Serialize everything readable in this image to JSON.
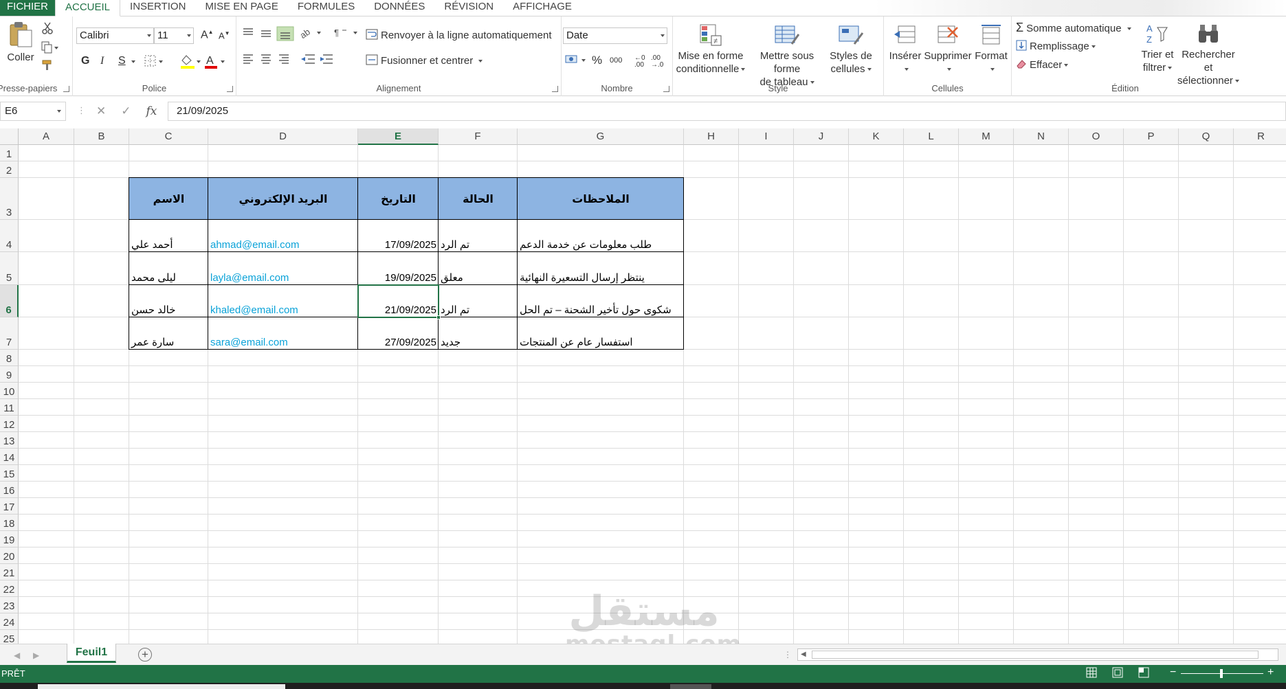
{
  "ribbon_tabs": [
    "FICHIER",
    "ACCUEIL",
    "INSERTION",
    "MISE EN PAGE",
    "FORMULES",
    "DONNÉES",
    "RÉVISION",
    "AFFICHAGE"
  ],
  "clipboard": {
    "paste": "Coller",
    "group": "Presse-papiers"
  },
  "font": {
    "name": "Calibri",
    "size": "11",
    "bold": "G",
    "italic": "I",
    "underline": "S",
    "group": "Police"
  },
  "alignment": {
    "wrap": "Renvoyer à la ligne automatiquement",
    "merge": "Fusionner et centrer",
    "group": "Alignement"
  },
  "number": {
    "format": "Date",
    "percent": "%",
    "thousands": "000",
    "group": "Nombre"
  },
  "style": {
    "conditional": [
      "Mise en forme",
      "conditionnelle"
    ],
    "table": [
      "Mettre sous forme",
      "de tableau"
    ],
    "cell_styles": [
      "Styles de",
      "cellules"
    ],
    "group": "Style"
  },
  "cells": {
    "insert": "Insérer",
    "delete": "Supprimer",
    "format": "Format",
    "group": "Cellules"
  },
  "editing": {
    "autosum": "Somme automatique",
    "fill": "Remplissage",
    "clear": "Effacer",
    "sort": [
      "Trier et",
      "filtrer"
    ],
    "find": [
      "Rechercher et",
      "sélectionner"
    ],
    "group": "Édition"
  },
  "formula_bar": {
    "name_box": "E6",
    "fx": "fx",
    "value": "21/09/2025"
  },
  "columns": [
    "A",
    "B",
    "C",
    "D",
    "E",
    "F",
    "G",
    "H",
    "I",
    "J",
    "K",
    "L",
    "M",
    "N",
    "O",
    "P",
    "Q",
    "R"
  ],
  "rows": [
    "1",
    "2",
    "3",
    "4",
    "5",
    "6",
    "7",
    "8",
    "9",
    "10",
    "11",
    "12",
    "13",
    "14",
    "15",
    "16",
    "17",
    "18",
    "19",
    "20",
    "21",
    "22",
    "23",
    "24",
    "25"
  ],
  "table": {
    "headers": {
      "name": "الاسم",
      "email": "البريد الإلكتروني",
      "date": "التاريخ",
      "status": "الحالة",
      "notes": "الملاحظات"
    },
    "rows": [
      {
        "name": "أحمد علي",
        "email": "ahmad@email.com",
        "date": "17/09/2025",
        "status": "تم الرد",
        "notes": "طلب معلومات عن خدمة الدعم"
      },
      {
        "name": "ليلى محمد",
        "email": "layla@email.com",
        "date": "19/09/2025",
        "status": "معلق",
        "notes": "ينتظر إرسال التسعيرة النهائية"
      },
      {
        "name": "خالد حسن",
        "email": "khaled@email.com",
        "date": "21/09/2025",
        "status": "تم الرد",
        "notes": "شكوى حول تأخير الشحنة – تم الحل"
      },
      {
        "name": "سارة عمر",
        "email": "sara@email.com",
        "date": "27/09/2025",
        "status": "جديد",
        "notes": "استفسار عام عن المنتجات"
      }
    ]
  },
  "watermark": {
    "arabic": "مستقل",
    "latin": "mostaql.com"
  },
  "sheet_tab": "Feuil1",
  "add_sheet": "+",
  "status_text": "PRÊT",
  "colors": {
    "excel_green": "#217346",
    "header_fill": "#8db4e2",
    "link": "#0aa2d8"
  }
}
